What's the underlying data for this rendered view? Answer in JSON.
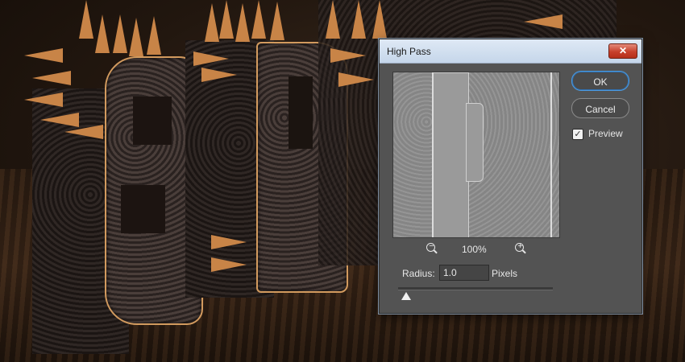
{
  "dialog": {
    "title": "High Pass",
    "close_glyph": "✕",
    "ok_label": "OK",
    "cancel_label": "Cancel",
    "preview_label": "Preview",
    "preview_checked": true,
    "check_glyph": "✓",
    "zoom_out_glyph": "−",
    "zoom_in_glyph": "+",
    "zoom_level": "100%",
    "radius_label": "Radius:",
    "radius_value": "1.0",
    "units_label": "Pixels",
    "slider_level": 0.0
  },
  "icons": {
    "close": "close-icon",
    "zoom_out": "zoom-out-icon",
    "zoom_in": "zoom-in-icon",
    "check": "check-icon"
  },
  "colors": {
    "dialog_bg": "#535353",
    "ok_accent": "#4d9be0",
    "close_red": "#c7402c",
    "spike_copper": "#c88447"
  }
}
